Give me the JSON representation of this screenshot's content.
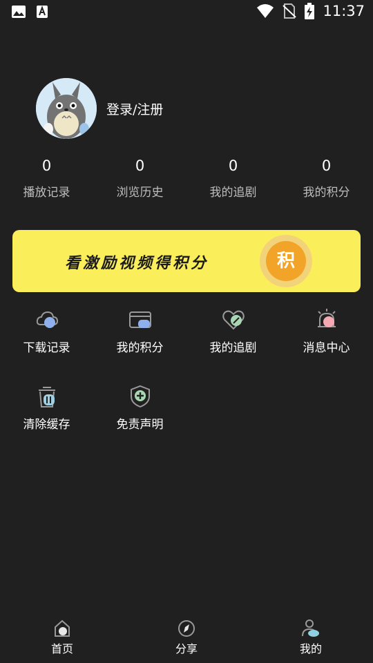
{
  "status_bar": {
    "time": "11:37",
    "icons": [
      "image-icon",
      "a-icon",
      "wifi-icon",
      "no-sim-icon",
      "battery-charging-icon"
    ]
  },
  "profile": {
    "login_text": "登录/注册",
    "avatar": "totoro-avatar"
  },
  "stats": [
    {
      "value": "0",
      "label": "播放记录"
    },
    {
      "value": "0",
      "label": "浏览历史"
    },
    {
      "value": "0",
      "label": "我的追剧"
    },
    {
      "value": "0",
      "label": "我的积分"
    }
  ],
  "banner": {
    "text": "看激励视频得积分",
    "coin_char": "积",
    "color": "#fbee5b"
  },
  "menu": [
    {
      "label": "下载记录",
      "icon": "cloud-download-icon"
    },
    {
      "label": "我的积分",
      "icon": "card-icon"
    },
    {
      "label": "我的追剧",
      "icon": "heart-icon"
    },
    {
      "label": "消息中心",
      "icon": "bell-icon"
    },
    {
      "label": "清除缓存",
      "icon": "trash-icon"
    },
    {
      "label": "免责声明",
      "icon": "shield-plus-icon"
    }
  ],
  "bottom_nav": [
    {
      "label": "首页",
      "icon": "home-icon"
    },
    {
      "label": "分享",
      "icon": "compass-icon"
    },
    {
      "label": "我的",
      "icon": "user-icon",
      "active": true
    }
  ]
}
